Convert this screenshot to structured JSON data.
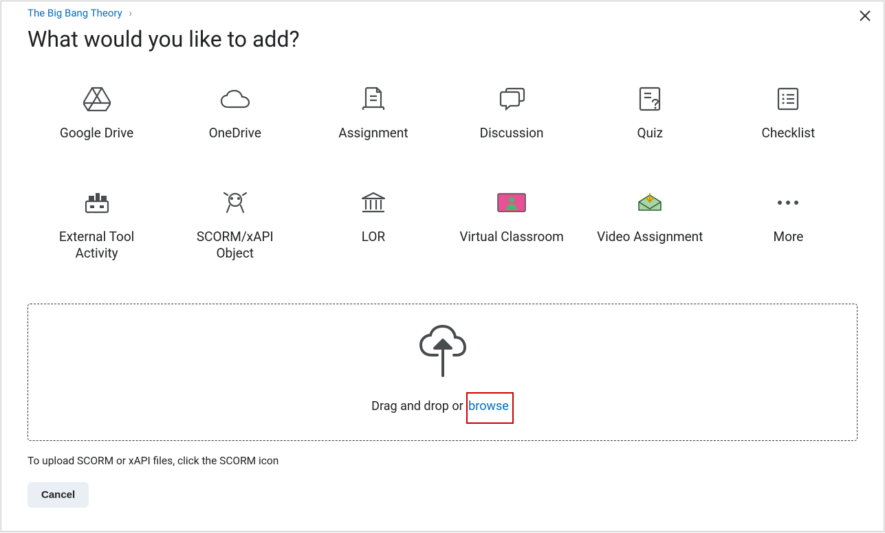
{
  "breadcrumb": {
    "label": "The Big Bang Theory"
  },
  "title": "What would you like to add?",
  "options": [
    {
      "label": "Google Drive"
    },
    {
      "label": "OneDrive"
    },
    {
      "label": "Assignment"
    },
    {
      "label": "Discussion"
    },
    {
      "label": "Quiz"
    },
    {
      "label": "Checklist"
    },
    {
      "label": "External Tool Activity"
    },
    {
      "label": "SCORM/xAPI Object"
    },
    {
      "label": "LOR"
    },
    {
      "label": "Virtual Classroom"
    },
    {
      "label": "Video Assignment"
    },
    {
      "label": "More"
    }
  ],
  "dropzone": {
    "text": "Drag and drop or ",
    "browse": "browse"
  },
  "hint": "To upload SCORM or xAPI files, click the SCORM icon",
  "cancel": "Cancel"
}
